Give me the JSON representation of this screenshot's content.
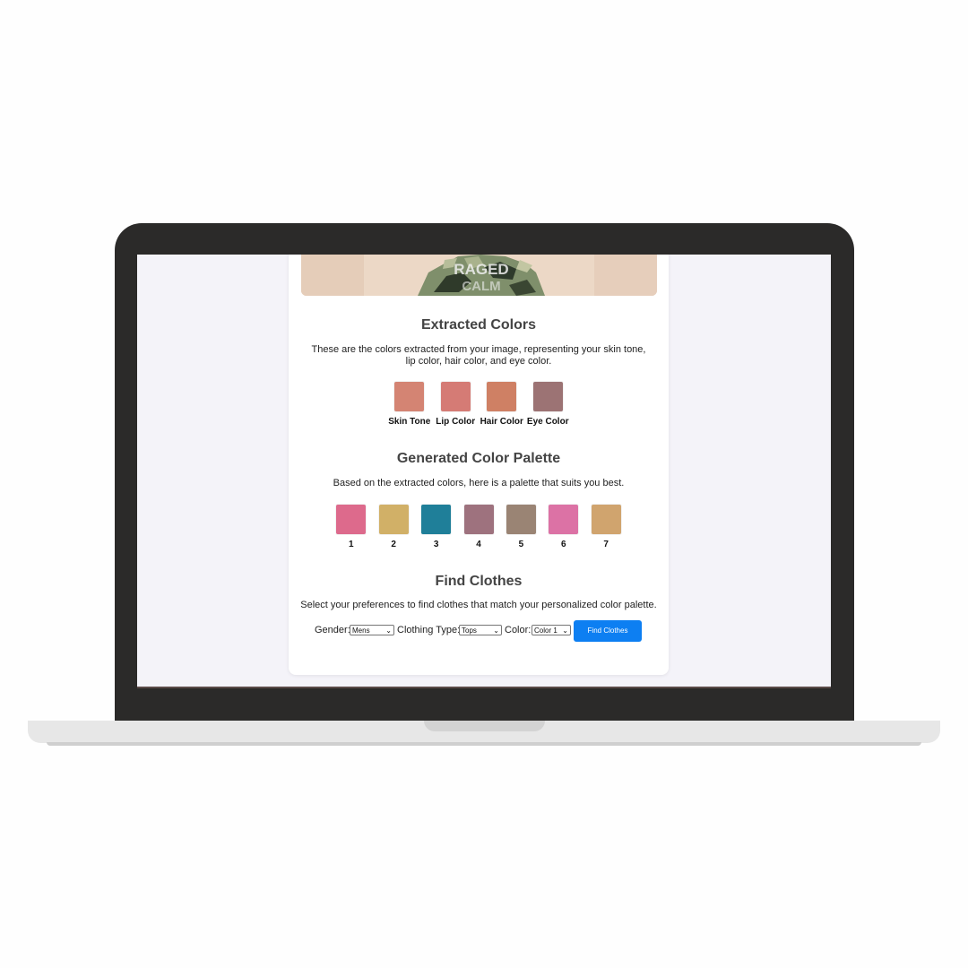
{
  "extracted": {
    "title": "Extracted Colors",
    "description": "These are the colors extracted from your image, representing your skin tone, lip color, hair color, and eye color.",
    "items": [
      {
        "label": "Skin Tone",
        "color": "#d48473"
      },
      {
        "label": "Lip Color",
        "color": "#d57b75"
      },
      {
        "label": "Hair Color",
        "color": "#cf8064"
      },
      {
        "label": "Eye Color",
        "color": "#9c7374"
      }
    ]
  },
  "palette": {
    "title": "Generated Color Palette",
    "description": "Based on the extracted colors, here is a palette that suits you best.",
    "items": [
      {
        "label": "1",
        "color": "#dd6a8c"
      },
      {
        "label": "2",
        "color": "#d1b067"
      },
      {
        "label": "3",
        "color": "#1f7f99"
      },
      {
        "label": "4",
        "color": "#9e727e"
      },
      {
        "label": "5",
        "color": "#9a8474"
      },
      {
        "label": "6",
        "color": "#dc72a5"
      },
      {
        "label": "7",
        "color": "#d0a46e"
      }
    ]
  },
  "find": {
    "title": "Find Clothes",
    "description": "Select your preferences to find clothes that match your personalized color palette.",
    "gender_label": "Gender:",
    "gender_value": "Mens",
    "type_label": "Clothing Type:",
    "type_value": "Tops",
    "color_label": "Color:",
    "color_value": "Color 1",
    "button_label": "Find Clothes"
  },
  "photo": {
    "shirt_text_line1": "RAGED",
    "shirt_text_line2": "CALM"
  },
  "colors": {
    "accent": "#0d7ff2",
    "screen_bg": "#f4f3f9",
    "laptop_frame": "#2b2a29"
  }
}
